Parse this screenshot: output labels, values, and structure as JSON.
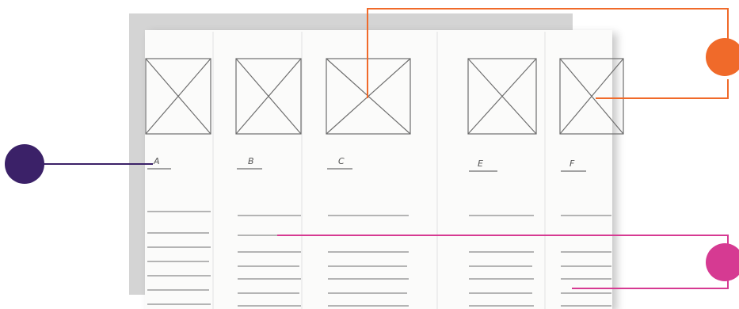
{
  "columns": [
    {
      "label": "A"
    },
    {
      "label": "B"
    },
    {
      "label": "C"
    },
    {
      "label": "E"
    },
    {
      "label": "F"
    }
  ],
  "colors": {
    "image_callout": "#f06a2a",
    "label_callout": "#3b2168",
    "text_callout": "#d63a92",
    "pencil": "#6e6e6e",
    "backing": "#d4d4d4"
  }
}
